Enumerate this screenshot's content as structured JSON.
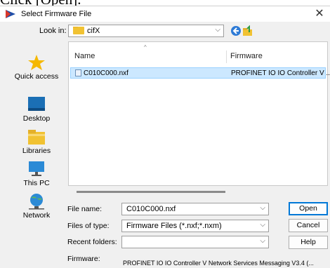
{
  "caption": "Click [Open].",
  "window": {
    "title": "Select Firmware File",
    "close": "✕"
  },
  "toolbar": {
    "look_in_label": "Look in:",
    "look_in_value": "cifX"
  },
  "sidebar": {
    "items": [
      {
        "label": "Quick access",
        "icon": "star-icon"
      },
      {
        "label": "Desktop",
        "icon": "desktop-icon"
      },
      {
        "label": "Libraries",
        "icon": "libraries-icon"
      },
      {
        "label": "This PC",
        "icon": "computer-icon"
      },
      {
        "label": "Network",
        "icon": "network-icon"
      }
    ]
  },
  "file_list": {
    "columns": [
      "Name",
      "Firmware"
    ],
    "rows": [
      {
        "name": "C010C000.nxf",
        "firmware": "PROFINET IO IO Controller V ..."
      }
    ]
  },
  "form": {
    "file_name_label": "File name:",
    "file_name_value": "C010C000.nxf",
    "file_type_label": "Files of type:",
    "file_type_value": "Firmware Files (*.nxf;*.nxm)",
    "recent_label": "Recent folders:",
    "recent_value": "",
    "firmware_label": "Firmware:",
    "firmware_value": "PROFINET IO IO Controller V Network Services Messaging V3.4 (..."
  },
  "buttons": {
    "open": "Open",
    "cancel": "Cancel",
    "help": "Help"
  },
  "colors": {
    "selection": "#cce8ff",
    "accent": "#0078d7"
  }
}
